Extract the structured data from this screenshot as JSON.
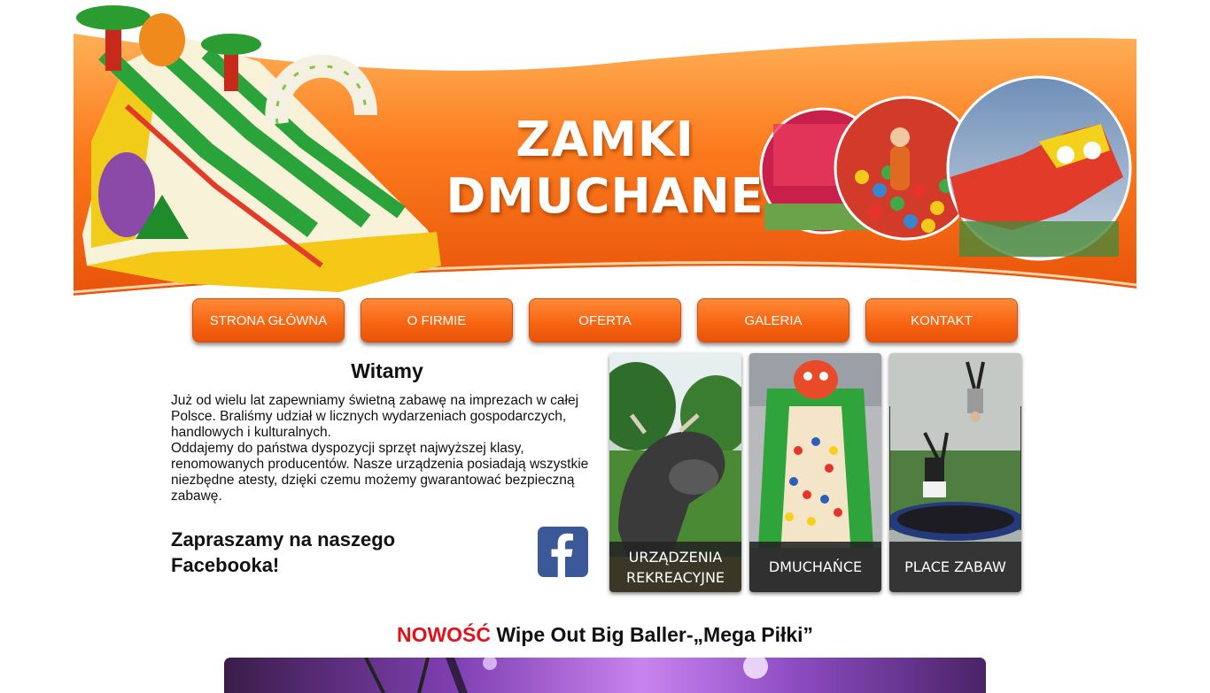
{
  "logo": {
    "line1": "ZAMKI",
    "line2": "DMUCHANE"
  },
  "colors": {
    "brand_orange": "#f76612",
    "news_red": "#e3111b",
    "facebook_blue": "#3b5998"
  },
  "nav": {
    "items": [
      {
        "label": "STRONA GŁÓWNA"
      },
      {
        "label": "O FIRMIE"
      },
      {
        "label": "OFERTA"
      },
      {
        "label": "GALERIA"
      },
      {
        "label": "KONTAKT"
      }
    ]
  },
  "welcome": {
    "title": "Witamy",
    "paragraph1": "Już od wielu lat zapewniamy świetną zabawę na imprezach w całej Polsce. Braliśmy udział w licznych wydarzeniach gospodarczych, handlowych i kulturalnych.",
    "paragraph2": "Oddajemy do państwa dyspozycji sprzęt najwyższej klasy, renomowanych producentów. Nasze urządzenia posiadają wszystkie niezbędne atesty, dzięki czemu możemy gwarantować bezpieczną zabawę."
  },
  "facebook": {
    "invite": "Zapraszamy na naszego Facebooka!",
    "icon": "facebook-icon"
  },
  "tiles": [
    {
      "caption": "URZĄDZENIA\nREKREACYJNE"
    },
    {
      "caption": "DMUCHAŃCE"
    },
    {
      "caption": "PLACE ZABAW"
    }
  ],
  "news": {
    "tag": "NOWOŚĆ",
    "title": "Wipe Out Big Baller-„Mega Piłki”"
  }
}
